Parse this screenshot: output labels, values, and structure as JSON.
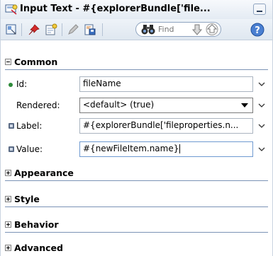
{
  "titlebar": {
    "title": "Input Text - #{explorerBundle['file..."
  },
  "toolbar": {
    "find_placeholder": "Find"
  },
  "sections": {
    "common": "Common",
    "appearance": "Appearance",
    "style": "Style",
    "behavior": "Behavior",
    "advanced": "Advanced"
  },
  "properties": {
    "id": {
      "label": "Id:",
      "value": "fileName"
    },
    "rendered": {
      "label": "Rendered:",
      "value": "<default> (true)"
    },
    "label": {
      "label": "Label:",
      "value": "#{explorerBundle['fileproperties.n..."
    },
    "value": {
      "label": "Value:",
      "value": "#{newFileItem.name}"
    }
  },
  "colors": {
    "section_line": "#7b93b5",
    "required_dot": "#2e8b3a"
  }
}
